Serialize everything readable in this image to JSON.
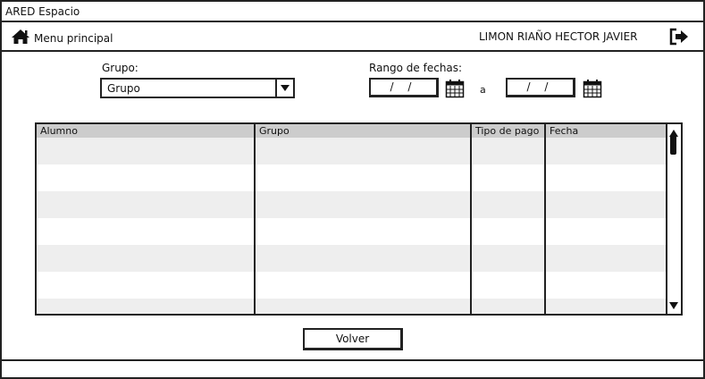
{
  "window": {
    "title": "ARED Espacio"
  },
  "nav": {
    "home_label": "Menu principal",
    "user_name": "LIMON RIAÑO HECTOR JAVIER"
  },
  "filters": {
    "group_label": "Grupo:",
    "group_value": "Grupo",
    "date_range_label": "Rango de fechas:",
    "date_from": "/ /",
    "date_to": "/ /",
    "separator": "a"
  },
  "table": {
    "columns": [
      "Alumno",
      "Grupo",
      "Tipo de pago",
      "Fecha"
    ],
    "rows": [
      [
        "",
        "",
        "",
        ""
      ],
      [
        "",
        "",
        "",
        ""
      ],
      [
        "",
        "",
        "",
        ""
      ],
      [
        "",
        "",
        "",
        ""
      ],
      [
        "",
        "",
        "",
        ""
      ],
      [
        "",
        "",
        "",
        ""
      ],
      [
        "",
        "",
        "",
        ""
      ]
    ]
  },
  "actions": {
    "back_label": "Volver"
  },
  "icons": {
    "home": "home-icon",
    "logout": "logout-icon",
    "dropdown": "chevron-down-icon",
    "calendar": "calendar-icon",
    "scroll_up": "scroll-up-icon",
    "scroll_down": "scroll-down-icon"
  }
}
